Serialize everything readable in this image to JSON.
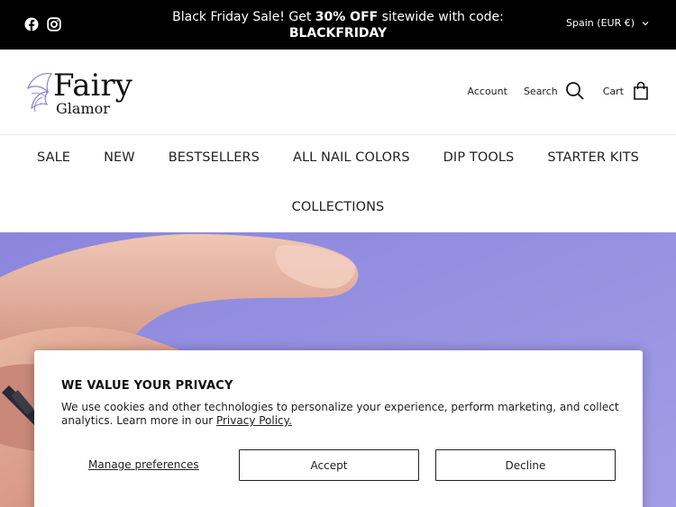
{
  "announcement": {
    "text_before": "Black Friday Sale! Get ",
    "text_bold": "30% OFF",
    "text_after": " sitewide with code:",
    "code": "BLACKFRIDAY",
    "locale": "Spain (EUR €)",
    "social": [
      "facebook-icon",
      "instagram-icon"
    ]
  },
  "header": {
    "logo_line1": "Fairy",
    "logo_line2": "Glamor",
    "account_label": "Account",
    "search_label": "Search",
    "cart_label": "Cart"
  },
  "nav": {
    "items": [
      "SALE",
      "NEW",
      "BESTSELLERS",
      "ALL NAIL COLORS",
      "DIP TOOLS",
      "STARTER KITS"
    ],
    "collections": "COLLECTIONS"
  },
  "cookie": {
    "title": "WE VALUE YOUR PRIVACY",
    "text": "We use cookies and other technologies to personalize your experience, perform marketing, and collect analytics. Learn more in our ",
    "link": "Privacy Policy.",
    "manage": "Manage preferences",
    "accept": "Accept",
    "decline": "Decline"
  },
  "colors": {
    "hero_bg": "#9690e0",
    "announcement_bg": "#000000",
    "logo_accent": "#8b7fd8"
  }
}
